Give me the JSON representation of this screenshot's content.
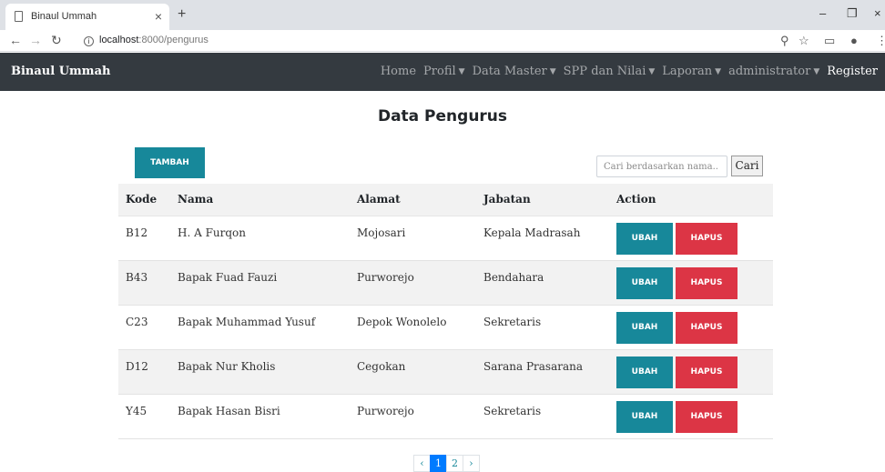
{
  "browser": {
    "tab_title": "Binaul Ummah",
    "tab_close": "×",
    "new_tab": "+",
    "url_host": "localhost",
    "url_path": ":8000/pengurus",
    "window_controls": [
      "–",
      "❐",
      "×"
    ]
  },
  "navbar": {
    "brand": "Binaul Ummah",
    "items": [
      {
        "label": "Home",
        "dropdown": false
      },
      {
        "label": "Profil",
        "dropdown": true
      },
      {
        "label": "Data Master",
        "dropdown": true
      },
      {
        "label": "SPP dan Nilai",
        "dropdown": true
      },
      {
        "label": "Laporan",
        "dropdown": true
      },
      {
        "label": "administrator",
        "dropdown": true
      },
      {
        "label": "Register",
        "dropdown": false
      }
    ]
  },
  "page": {
    "title": "Data Pengurus",
    "add_button": "TAMBAH",
    "search_placeholder": "Cari berdasarkan nama..",
    "search_button": "Cari"
  },
  "table": {
    "headers": [
      "Kode",
      "Nama",
      "Alamat",
      "Jabatan",
      "Action"
    ],
    "edit_label": "UBAH",
    "delete_label": "HAPUS",
    "rows": [
      {
        "kode": "B12",
        "nama": "H. A Furqon",
        "alamat": "Mojosari",
        "jabatan": "Kepala Madrasah"
      },
      {
        "kode": "B43",
        "nama": "Bapak Fuad Fauzi",
        "alamat": "Purworejo",
        "jabatan": "Bendahara"
      },
      {
        "kode": "C23",
        "nama": "Bapak Muhammad Yusuf",
        "alamat": "Depok Wonolelo",
        "jabatan": "Sekretaris"
      },
      {
        "kode": "D12",
        "nama": "Bapak Nur Kholis",
        "alamat": "Cegokan",
        "jabatan": "Sarana Prasarana"
      },
      {
        "kode": "Y45",
        "nama": "Bapak Hasan Bisri",
        "alamat": "Purworejo",
        "jabatan": "Sekretaris"
      }
    ]
  },
  "pagination": {
    "prev": "‹",
    "pages": [
      "1",
      "2"
    ],
    "active": "1",
    "next": "›"
  },
  "colors": {
    "navbar_bg": "#343a40",
    "primary_teal": "#17889a",
    "danger": "#dc3545",
    "page_active": "#007bff"
  }
}
